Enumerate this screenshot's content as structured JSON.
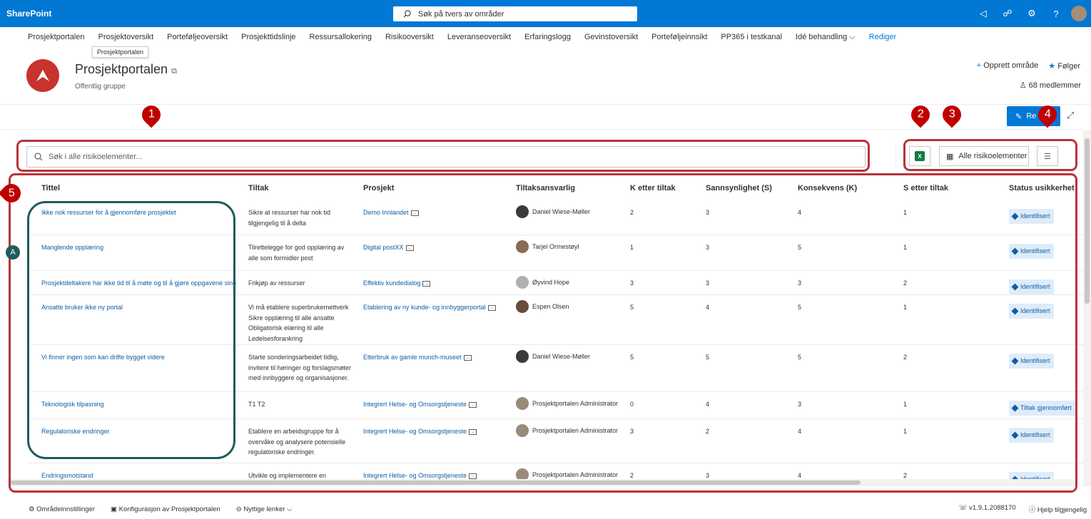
{
  "topbar": {
    "brand": "SharePoint",
    "search_placeholder": "Søk på tvers av områder"
  },
  "nav": {
    "items": [
      "Prosjektportalen",
      "Prosjektoversikt",
      "Porteføljeoversikt",
      "Prosjekttidslinje",
      "Ressursallokering",
      "Risikooversikt",
      "Leveranseoversikt",
      "Erfaringslogg",
      "Gevinstoversikt",
      "Porteføljeinnsikt",
      "PP365 i testkanal",
      "Idé behandling"
    ],
    "edit": "Rediger",
    "tooltip": "Prosjektportalen"
  },
  "site": {
    "title": "Prosjektportalen",
    "subtitle": "Offentlig gruppe",
    "create": "Opprett område",
    "follow": "Følger",
    "members": "68 medlemmer"
  },
  "toolbar": {
    "edit_label": "Re",
    "search_placeholder": "Søk i alle risikoelementer...",
    "view_label": "Alle risikoelementer"
  },
  "table": {
    "columns": [
      "Tittel",
      "Tiltak",
      "Prosjekt",
      "Tiltaksansvarlig",
      "K etter tiltak",
      "Sannsynlighet (S)",
      "Konsekvens (K)",
      "S etter tiltak",
      "Status usikkerhet"
    ],
    "rows": [
      {
        "title": "Ikke nok ressurser for å gjennomføre prosjektet",
        "tiltak": [
          "Sikre at ressurser har nok tid",
          "tilgjengelig til å delta"
        ],
        "project": "Demo Innlandet",
        "owner": "Daniel Wiese-Møller",
        "k_after": "2",
        "s": "3",
        "k": "4",
        "s_after": "1",
        "status": "Identifisert"
      },
      {
        "title": "Manglende opplæring",
        "tiltak": [
          "Tilrettelegge for god opplæring av",
          "alle som formidler post"
        ],
        "project": "Digital postXX",
        "owner": "Tarjei Ormestøyl",
        "k_after": "1",
        "s": "3",
        "k": "5",
        "s_after": "1",
        "status": "Identifisert"
      },
      {
        "title": "Prosjektdeltakere har ikke tid til å møte og til å gjøre oppgavene sine",
        "tiltak": [
          "Frikjøp av ressurser"
        ],
        "project": "Effektiv kundedialog",
        "owner": "Øyvind Hope",
        "k_after": "3",
        "s": "3",
        "k": "3",
        "s_after": "2",
        "status": "Identifisert"
      },
      {
        "title": "Ansatte bruker ikke ny portal",
        "tiltak": [
          "Vi må etablere superbrukernettverk",
          "Sikre opplæring til alle ansatte",
          "Obligatorisk elæring til alle",
          "Ledelsesforankring"
        ],
        "project": "Etablering av ny kunde- og innbyggerportal",
        "owner": "Espen Olsen",
        "k_after": "5",
        "s": "4",
        "k": "5",
        "s_after": "1",
        "status": "Identifisert"
      },
      {
        "title": "Vi finner ingen som kan drifte bygget videre",
        "tiltak": [
          "Starte sonderingsarbeidet tidlig,",
          "invitere til høringer og forslagsmøter",
          "med innbyggere og organisasjoner."
        ],
        "project": "Etterbruk av gamle munch-museet",
        "owner": "Daniel Wiese-Møller",
        "k_after": "5",
        "s": "5",
        "k": "5",
        "s_after": "2",
        "status": "Identifisert"
      },
      {
        "title": "Teknologisk tilpasning",
        "tiltak": [
          "T1 T2"
        ],
        "project": "Integrert Helse- og Omsorgstjeneste",
        "owner": "Prosjektportalen Administrator",
        "k_after": "0",
        "s": "4",
        "k": "3",
        "s_after": "1",
        "status": "Tiltak gjennomført"
      },
      {
        "title": "Regulatoriske endringer",
        "tiltak": [
          "Etablere en arbeidsgruppe for å",
          "overvåke og analysere potensielle",
          "regulatoriske endringer."
        ],
        "project": "Integrert Helse- og Omsorgstjeneste",
        "owner": "Prosjektportalen Administrator",
        "k_after": "3",
        "s": "2",
        "k": "4",
        "s_after": "1",
        "status": "Identifisert"
      },
      {
        "title": "Endringsmotstand",
        "tiltak": [
          "Utvikle og implementere en"
        ],
        "project": "Integrert Helse- og Omsorgstjeneste",
        "owner": "Prosjektportalen Administrator",
        "k_after": "2",
        "s": "3",
        "k": "4",
        "s_after": "2",
        "status": "Identifisert"
      }
    ]
  },
  "footer": {
    "settings": "Områdeinnstillinger",
    "config": "Konfigurasjon av Prosjektportalen",
    "links": "Nyttige lenker",
    "version": "v1.9.1.2088170",
    "help": "Hjelp tilgjengelig"
  },
  "annotations": {
    "pins": [
      "1",
      "2",
      "3",
      "4",
      "5"
    ],
    "circle": "A"
  },
  "colors": {
    "brand_blue": "#0078d4",
    "annotation_red": "#c00000",
    "annotation_green": "#1e5c5c"
  }
}
